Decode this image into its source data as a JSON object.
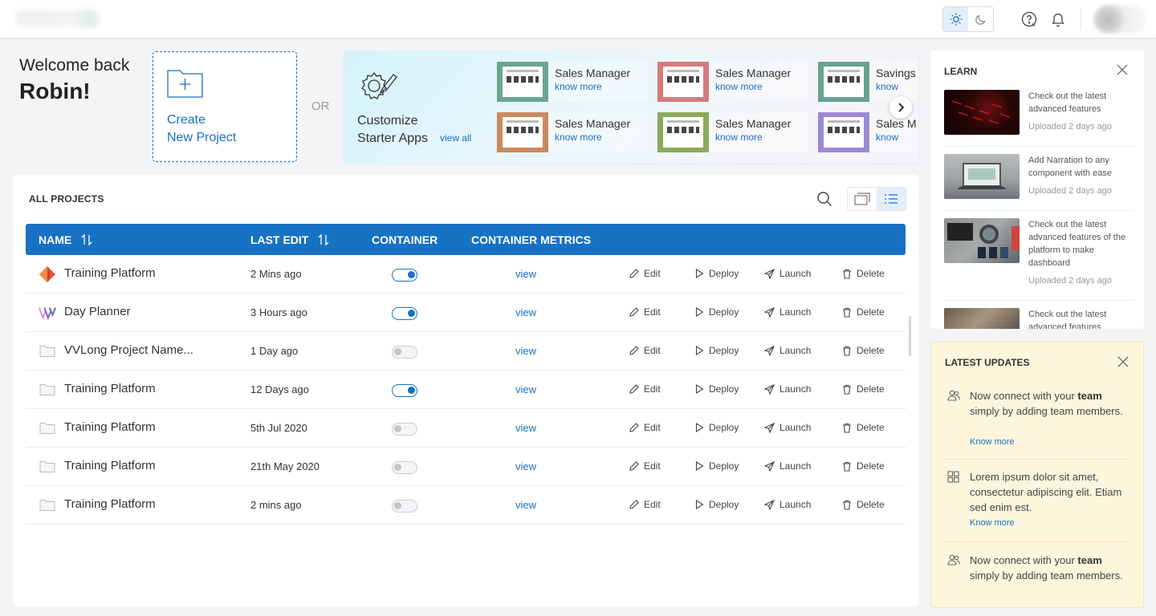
{
  "header": {
    "theme": {
      "light_icon": "sun-icon",
      "dark_icon": "moon-icon",
      "active": "light"
    },
    "help_icon": "help-circle-icon",
    "notification_icon": "bell-icon"
  },
  "welcome": {
    "greeting": "Welcome back",
    "name": "Robin!"
  },
  "create_card": {
    "line1": "Create",
    "line2": "New Project"
  },
  "or_label": "OR",
  "starter": {
    "title_line1": "Customize",
    "title_line2": "Starter Apps",
    "view_all": "view all",
    "apps": [
      {
        "title": "Sales Manager",
        "link": "know more",
        "color": "#6aa594"
      },
      {
        "title": "Sales Manager",
        "link": "know more",
        "color": "#d47b7b"
      },
      {
        "title": "Savings",
        "link": "know",
        "color": "#66a391"
      },
      {
        "title": "Sales Manager",
        "link": "know more",
        "color": "#c98a5e"
      },
      {
        "title": "Sales Manager",
        "link": "know more",
        "color": "#8aaa5a"
      },
      {
        "title": "Sales M",
        "link": "know",
        "color": "#9b8ad4"
      }
    ]
  },
  "projects": {
    "title": "ALL PROJECTS",
    "columns": {
      "name": "NAME",
      "last_edit": "LAST EDIT",
      "container": "CONTAINER",
      "metrics": "CONTAINER METRICS"
    },
    "actions": {
      "edit": "Edit",
      "deploy": "Deploy",
      "launch": "Launch",
      "delete": "Delete",
      "view": "view"
    },
    "rows": [
      {
        "name": "Training Platform",
        "last_edit": "2 Mins ago",
        "container": true,
        "icon": "diamond-logo-icon"
      },
      {
        "name": "Day Planner",
        "last_edit": "3 Hours ago",
        "container": true,
        "icon": "w-logo-icon"
      },
      {
        "name": "VVLong Project Name...",
        "last_edit": "1 Day ago",
        "container": false,
        "icon": "folder-icon"
      },
      {
        "name": "Training Platform",
        "last_edit": "12 Days ago",
        "container": true,
        "icon": "folder-icon"
      },
      {
        "name": "Training Platform",
        "last_edit": "5th Jul 2020",
        "container": false,
        "icon": "folder-icon"
      },
      {
        "name": "Training Platform",
        "last_edit": "21th May 2020",
        "container": false,
        "icon": "folder-icon"
      },
      {
        "name": "Training Platform",
        "last_edit": "2 mins ago",
        "container": false,
        "icon": "folder-icon"
      }
    ]
  },
  "learn": {
    "title": "LEARN",
    "items": [
      {
        "title": "Check out the latest advanced features",
        "date": "Uploaded 2 days ago"
      },
      {
        "title": "Add Narration to any component with ease",
        "date": "Uploaded 2 days ago"
      },
      {
        "title": "Check out the latest advanced features of the platform to make dashboard",
        "date": "Uploaded 2 days ago"
      },
      {
        "title": "Check out the latest advanced features",
        "date": ""
      }
    ]
  },
  "updates": {
    "title": "LATEST UPDATES",
    "items": [
      {
        "pre": "Now connect with your ",
        "bold": "team",
        "post": " simply by adding team members.",
        "link": "Know more",
        "icon": "users-icon"
      },
      {
        "pre": "Lorem ipsum dolor sit amet, consectetur adipiscing elit. Etiam sed enim est.",
        "bold": "",
        "post": "",
        "link": "Know more",
        "icon": "grid-icon"
      },
      {
        "pre": "Now connect with your ",
        "bold": "team",
        "post": " simply by adding team members.",
        "link": "",
        "icon": "users-icon"
      }
    ]
  },
  "colors": {
    "primary": "#1872c4",
    "link": "#1a6fc1",
    "updates_bg": "#fdf6dc"
  }
}
